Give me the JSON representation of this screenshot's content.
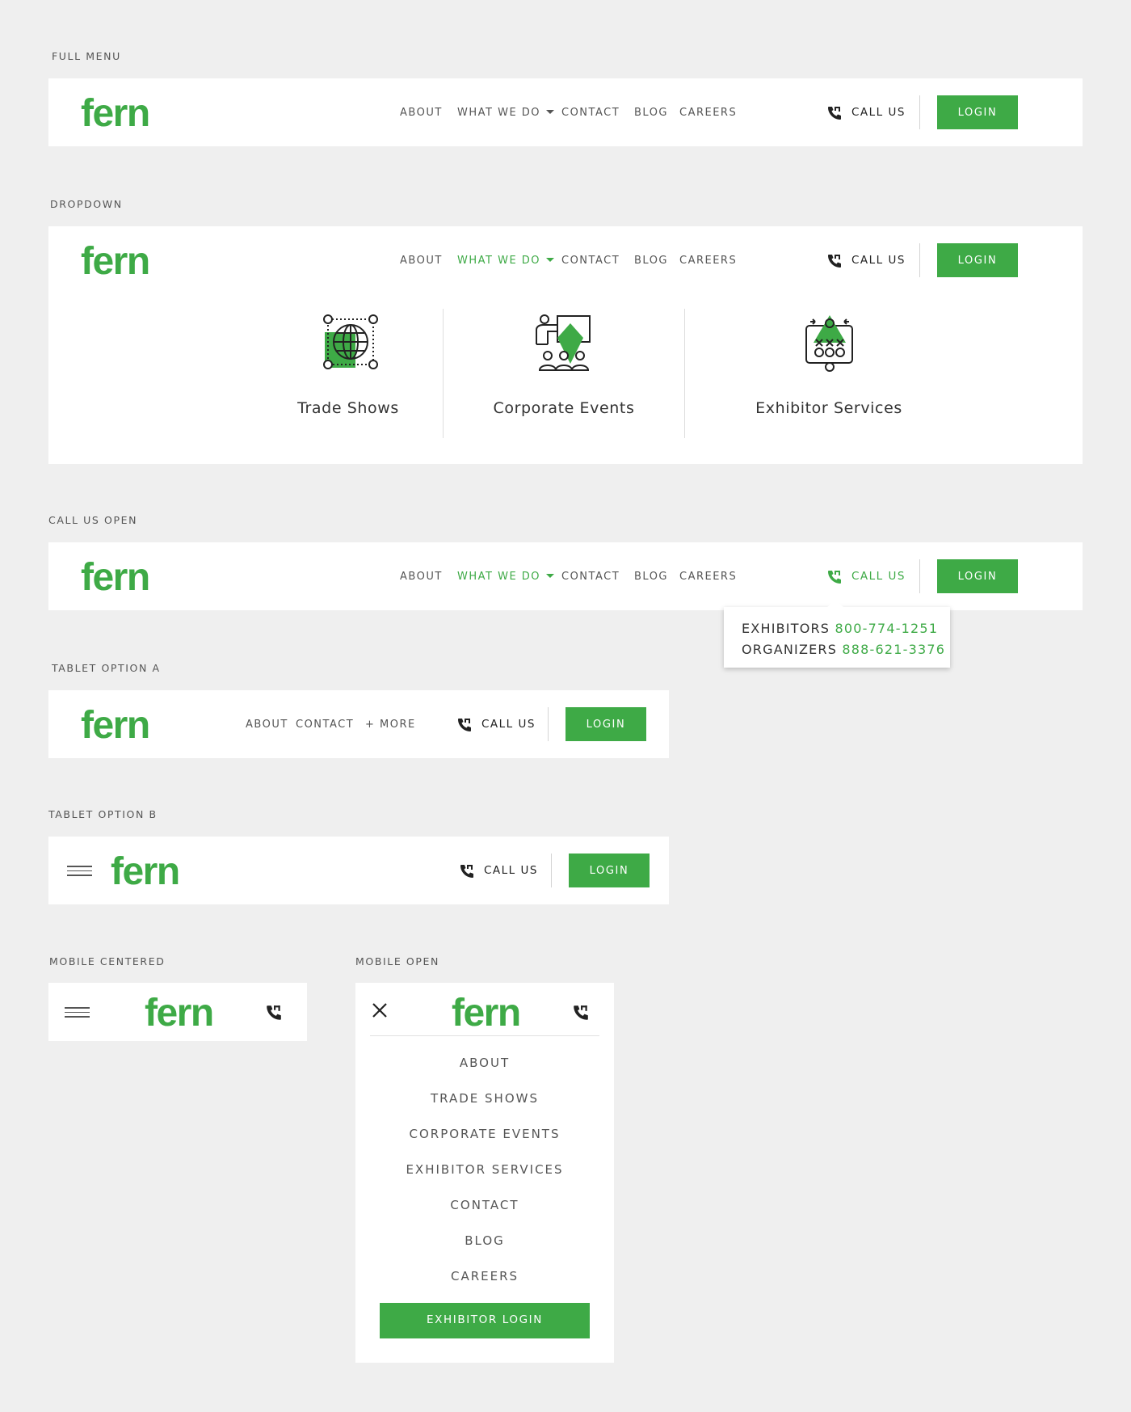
{
  "brand": {
    "logo_text": "fern",
    "accent_color": "#3eaa46"
  },
  "sections": {
    "full_menu": "FULL MENU",
    "dropdown": "DROPDOWN",
    "call_us_open": "CALL US OPEN",
    "tablet_a": "TABLET OPTION A",
    "tablet_b": "TABLET OPTION B",
    "mobile_centered": "MOBILE CENTERED",
    "mobile_open": "MOBILE OPEN"
  },
  "nav": {
    "about": "ABOUT",
    "what_we_do": "WHAT WE DO",
    "contact": "CONTACT",
    "blog": "BLOG",
    "careers": "CAREERS",
    "more": "+ MORE",
    "call_us": "CALL US",
    "login": "LOGIN"
  },
  "dropdown_items": [
    {
      "label": "Trade Shows",
      "icon": "globe-network-icon"
    },
    {
      "label": "Corporate Events",
      "icon": "presentation-icon"
    },
    {
      "label": "Exhibitor Services",
      "icon": "strategy-board-icon"
    }
  ],
  "call_popover": {
    "exhibitors_label": "EXHIBITORS",
    "exhibitors_number": "800-774-1251",
    "organizers_label": "ORGANIZERS",
    "organizers_number": "888-621-3376"
  },
  "mobile_menu": {
    "items": [
      "ABOUT",
      "TRADE SHOWS",
      "CORPORATE EVENTS",
      "EXHIBITOR SERVICES",
      "CONTACT",
      "BLOG",
      "CAREERS"
    ],
    "cta": "EXHIBITOR LOGIN"
  }
}
